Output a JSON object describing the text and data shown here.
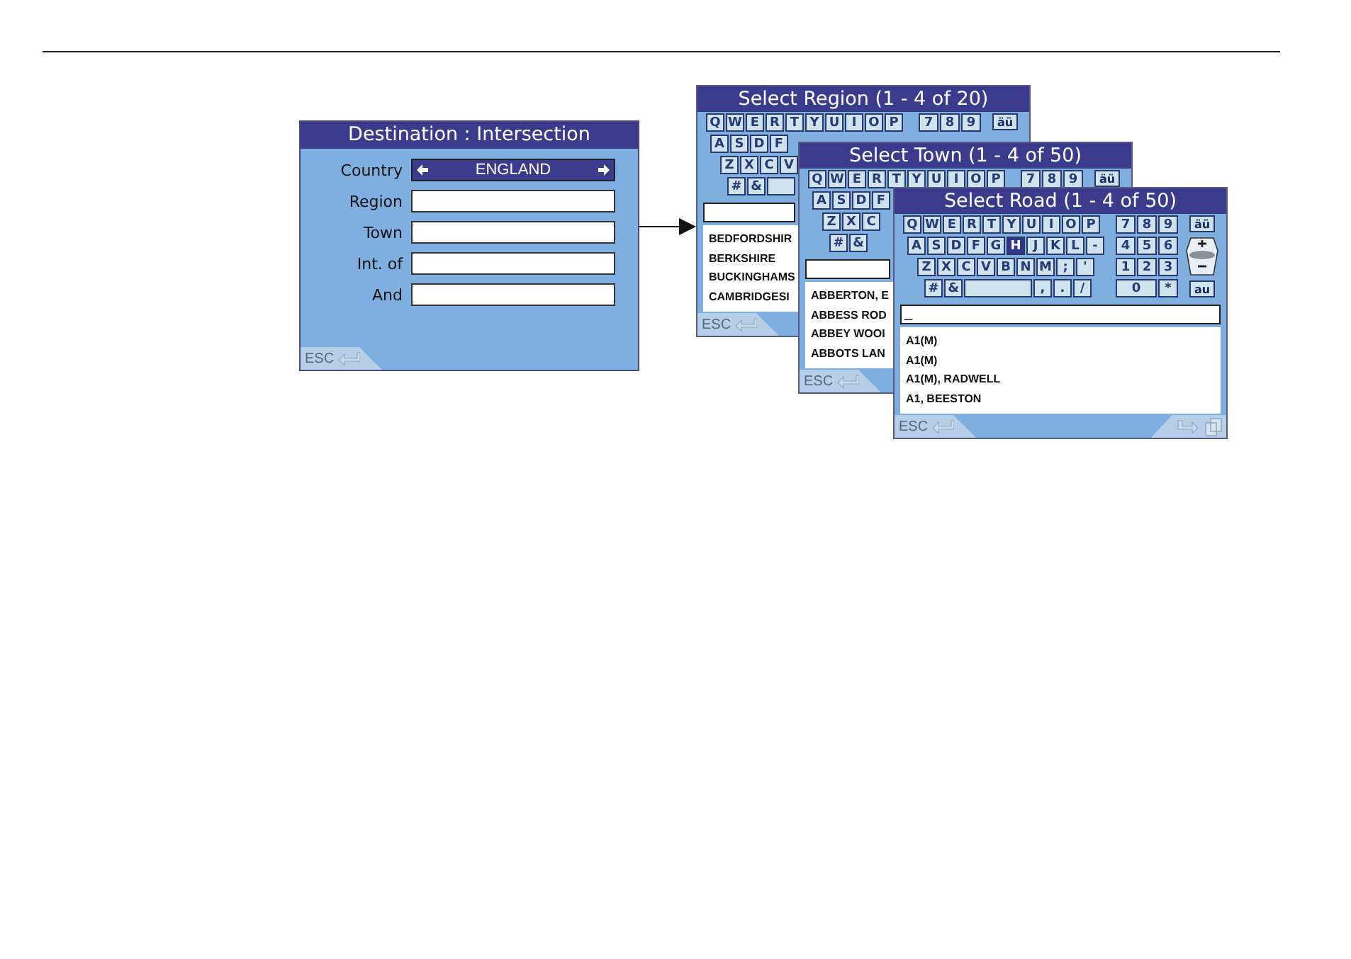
{
  "destination_screen": {
    "title": "Destination : Intersection",
    "fields": [
      {
        "label": "Country",
        "kind": "selector",
        "value": "ENGLAND"
      },
      {
        "label": "Region",
        "kind": "text"
      },
      {
        "label": "Town",
        "kind": "text"
      },
      {
        "label": "Int. of",
        "kind": "text"
      },
      {
        "label": "And",
        "kind": "text"
      }
    ],
    "esc": "ESC"
  },
  "select_screens": [
    {
      "title": "Select Region (1 - 4 of 20)",
      "keyboard": [
        [
          {
            "kind": "char",
            "label": "Q",
            "selected": false
          },
          {
            "kind": "char",
            "label": "W",
            "selected": false
          },
          {
            "kind": "char",
            "label": "E",
            "selected": false
          },
          {
            "kind": "char",
            "label": "R",
            "selected": false
          },
          {
            "kind": "char",
            "label": "T",
            "selected": false
          },
          {
            "kind": "char",
            "label": "Y",
            "selected": false
          },
          {
            "kind": "char",
            "label": "U",
            "selected": false
          },
          {
            "kind": "char",
            "label": "I",
            "selected": false
          },
          {
            "kind": "char",
            "label": "O",
            "selected": false
          },
          {
            "kind": "char",
            "label": "P",
            "selected": false
          }
        ],
        [
          {
            "kind": "char",
            "label": "A",
            "selected": false
          },
          {
            "kind": "char",
            "label": "S",
            "selected": false
          },
          {
            "kind": "char",
            "label": "D",
            "selected": false
          },
          {
            "kind": "char",
            "label": "F",
            "selected": false
          }
        ],
        [
          {
            "kind": "char",
            "label": "Z",
            "selected": false
          },
          {
            "kind": "char",
            "label": "X",
            "selected": false
          },
          {
            "kind": "char",
            "label": "C",
            "selected": false
          },
          {
            "kind": "char",
            "label": "V",
            "selected": false
          }
        ],
        [
          {
            "kind": "char",
            "label": "#",
            "selected": false
          },
          {
            "kind": "char",
            "label": "&",
            "selected": false
          },
          {
            "kind": "space",
            "selected": false
          }
        ]
      ],
      "numpad": [
        [
          "7",
          "8",
          "9"
        ]
      ],
      "side_buttons": [
        "äü"
      ],
      "results": [
        "BEDFORDSHIR",
        "BERKSHIRE",
        "BUCKINGHAMS",
        "CAMBRIDGESI"
      ],
      "esc": "ESC"
    },
    {
      "title": "Select Town (1 - 4 of 50)",
      "keyboard": [
        [
          {
            "kind": "char",
            "label": "Q",
            "selected": false
          },
          {
            "kind": "char",
            "label": "W",
            "selected": false
          },
          {
            "kind": "char",
            "label": "E",
            "selected": false
          },
          {
            "kind": "char",
            "label": "R",
            "selected": false
          },
          {
            "kind": "char",
            "label": "T",
            "selected": false
          },
          {
            "kind": "char",
            "label": "Y",
            "selected": false
          },
          {
            "kind": "char",
            "label": "U",
            "selected": false
          },
          {
            "kind": "char",
            "label": "I",
            "selected": false
          },
          {
            "kind": "char",
            "label": "O",
            "selected": false
          },
          {
            "kind": "char",
            "label": "P",
            "selected": false
          }
        ],
        [
          {
            "kind": "char",
            "label": "A",
            "selected": false
          },
          {
            "kind": "char",
            "label": "S",
            "selected": false
          },
          {
            "kind": "char",
            "label": "D",
            "selected": false
          },
          {
            "kind": "char",
            "label": "F",
            "selected": false
          }
        ],
        [
          {
            "kind": "char",
            "label": "Z",
            "selected": false
          },
          {
            "kind": "char",
            "label": "X",
            "selected": false
          },
          {
            "kind": "char",
            "label": "C",
            "selected": false
          }
        ],
        [
          {
            "kind": "char",
            "label": "#",
            "selected": false
          },
          {
            "kind": "char",
            "label": "&",
            "selected": false
          }
        ]
      ],
      "numpad": [
        [
          "7",
          "8",
          "9"
        ]
      ],
      "side_buttons": [
        "äü"
      ],
      "results": [
        "ABBERTON, E",
        "ABBESS ROD",
        "ABBEY WOOI",
        "ABBOTS LAN"
      ],
      "esc": "ESC"
    },
    {
      "title": "Select Road (1 - 4 of 50)",
      "keyboard": [
        [
          {
            "kind": "char",
            "label": "Q",
            "selected": false
          },
          {
            "kind": "char",
            "label": "W",
            "selected": false
          },
          {
            "kind": "char",
            "label": "E",
            "selected": false
          },
          {
            "kind": "char",
            "label": "R",
            "selected": false
          },
          {
            "kind": "char",
            "label": "T",
            "selected": false
          },
          {
            "kind": "char",
            "label": "Y",
            "selected": false
          },
          {
            "kind": "char",
            "label": "U",
            "selected": false
          },
          {
            "kind": "char",
            "label": "I",
            "selected": false
          },
          {
            "kind": "char",
            "label": "O",
            "selected": false
          },
          {
            "kind": "char",
            "label": "P",
            "selected": false
          }
        ],
        [
          {
            "kind": "char",
            "label": "A",
            "selected": false
          },
          {
            "kind": "char",
            "label": "S",
            "selected": false
          },
          {
            "kind": "char",
            "label": "D",
            "selected": false
          },
          {
            "kind": "char",
            "label": "F",
            "selected": false
          },
          {
            "kind": "char",
            "label": "G",
            "selected": false
          },
          {
            "kind": "char",
            "label": "H",
            "selected": true
          },
          {
            "kind": "char",
            "label": "J",
            "selected": false
          },
          {
            "kind": "char",
            "label": "K",
            "selected": false
          },
          {
            "kind": "char",
            "label": "L",
            "selected": false
          },
          {
            "kind": "char",
            "label": "-",
            "selected": false
          }
        ],
        [
          {
            "kind": "char",
            "label": "Z",
            "selected": false
          },
          {
            "kind": "char",
            "label": "X",
            "selected": false
          },
          {
            "kind": "char",
            "label": "C",
            "selected": false
          },
          {
            "kind": "char",
            "label": "V",
            "selected": false
          },
          {
            "kind": "char",
            "label": "B",
            "selected": false
          },
          {
            "kind": "char",
            "label": "N",
            "selected": false
          },
          {
            "kind": "char",
            "label": "M",
            "selected": false
          },
          {
            "kind": "char",
            "label": ";",
            "selected": false
          },
          {
            "kind": "char",
            "label": "'",
            "selected": false
          }
        ],
        [
          {
            "kind": "char",
            "label": "#",
            "selected": false
          },
          {
            "kind": "char",
            "label": "&",
            "selected": false
          },
          {
            "kind": "space",
            "selected": false
          },
          {
            "kind": "char",
            "label": ",",
            "selected": false
          },
          {
            "kind": "char",
            "label": ".",
            "selected": false
          },
          {
            "kind": "char",
            "label": "/",
            "selected": false
          }
        ]
      ],
      "numpad": [
        [
          "7",
          "8",
          "9"
        ],
        [
          "4",
          "5",
          "6"
        ],
        [
          "1",
          "2",
          "3"
        ],
        [
          "0",
          "*"
        ]
      ],
      "side_buttons": [
        "äü",
        "au"
      ],
      "zoom_control": true,
      "input": "_",
      "results": [
        "A1(M)",
        "A1(M)",
        "A1(M), RADWELL",
        "A1, BEESTON"
      ],
      "esc": "ESC",
      "forward_controls": true
    }
  ]
}
